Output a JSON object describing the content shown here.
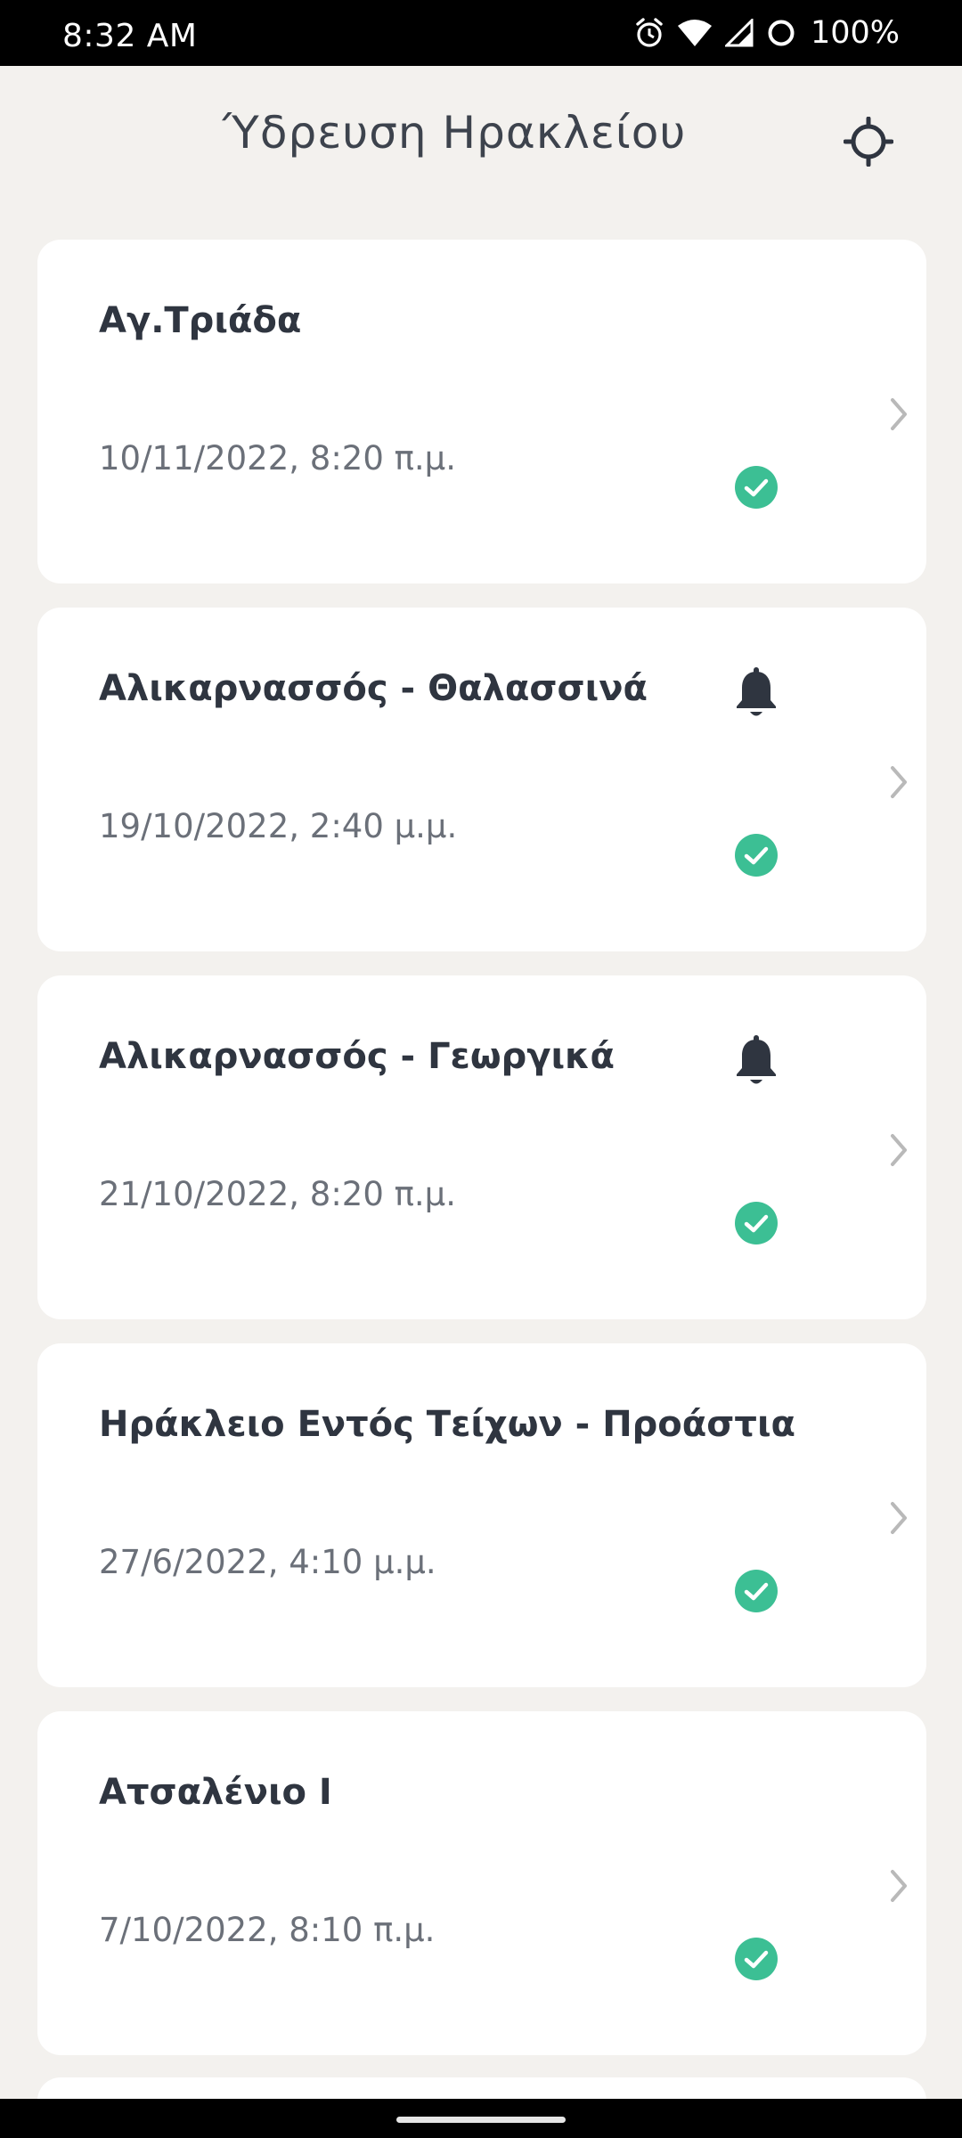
{
  "status_bar": {
    "time": "8:32 AM",
    "battery": "100%",
    "icons": [
      "alarm-icon",
      "wifi-icon",
      "signal-icon",
      "battery-icon"
    ]
  },
  "header": {
    "title": "Ύδρευση Ηρακλείου",
    "locate_icon": "crosshair-icon"
  },
  "colors": {
    "background": "#f3f1ee",
    "card": "#ffffff",
    "check": "#3cbf94",
    "bell": "#2f3540",
    "chevron": "#b9b9b9"
  },
  "areas": [
    {
      "name": "Αγ.Τριάδα",
      "date": "10/11/2022, 8:20 π.μ.",
      "has_alert": false,
      "status": "ok"
    },
    {
      "name": "Αλικαρνασσός - Θαλασσινά",
      "date": "19/10/2022, 2:40 μ.μ.",
      "has_alert": true,
      "status": "ok"
    },
    {
      "name": "Αλικαρνασσός - Γεωργικά",
      "date": "21/10/2022, 8:20 π.μ.",
      "has_alert": true,
      "status": "ok"
    },
    {
      "name": "Ηράκλειο Εντός Τείχων - Προάστια",
      "date": "27/6/2022, 4:10 μ.μ.",
      "has_alert": false,
      "status": "ok"
    },
    {
      "name": "Ατσαλένιο Ι",
      "date": "7/10/2022, 8:10 π.μ.",
      "has_alert": false,
      "status": "ok"
    }
  ]
}
